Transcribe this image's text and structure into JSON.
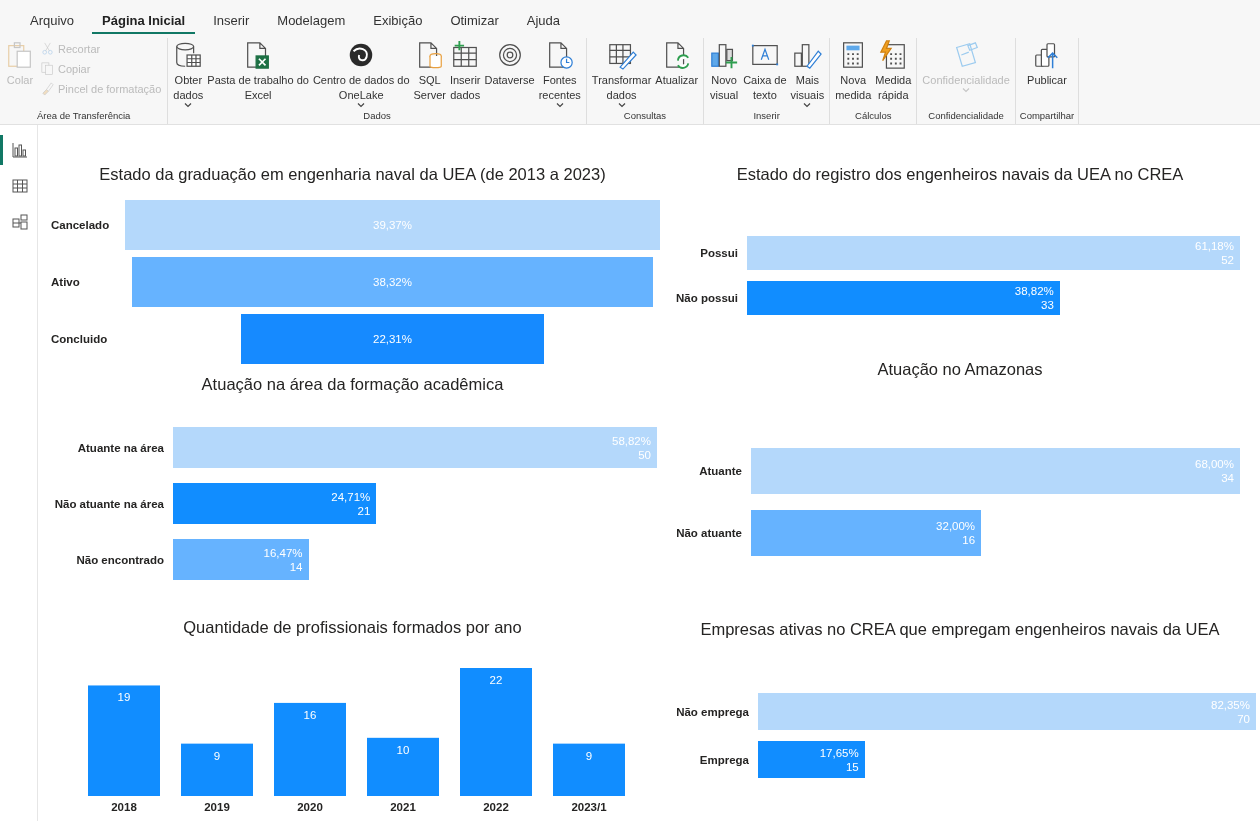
{
  "ribbon": {
    "tabs": [
      {
        "label": "Arquivo",
        "selected": false
      },
      {
        "label": "Página Inicial",
        "selected": true
      },
      {
        "label": "Inserir",
        "selected": false
      },
      {
        "label": "Modelagem",
        "selected": false
      },
      {
        "label": "Exibição",
        "selected": false
      },
      {
        "label": "Otimizar",
        "selected": false
      },
      {
        "label": "Ajuda",
        "selected": false
      }
    ],
    "groups": [
      {
        "label": "Área de Transferência",
        "items": [
          {
            "kind": "large",
            "label": "Colar",
            "disabled": true,
            "dropdown": false
          },
          {
            "kind": "small",
            "label": "Recortar",
            "disabled": true,
            "dropdown": false
          },
          {
            "kind": "small",
            "label": "Copiar",
            "disabled": true,
            "dropdown": false
          },
          {
            "kind": "small",
            "label": "Pincel de formatação",
            "disabled": true,
            "dropdown": false
          }
        ]
      },
      {
        "label": "Dados",
        "items": [
          {
            "kind": "large",
            "label": "Obter\ndados",
            "disabled": false,
            "dropdown": true
          },
          {
            "kind": "large",
            "label": "Pasta de trabalho do\nExcel",
            "disabled": false,
            "dropdown": false
          },
          {
            "kind": "large",
            "label": "Centro de dados do\nOneLake",
            "disabled": false,
            "dropdown": true
          },
          {
            "kind": "large",
            "label": "SQL\nServer",
            "disabled": false,
            "dropdown": false
          },
          {
            "kind": "large",
            "label": "Inserir\ndados",
            "disabled": false,
            "dropdown": false
          },
          {
            "kind": "large",
            "label": "Dataverse",
            "disabled": false,
            "dropdown": false
          },
          {
            "kind": "large",
            "label": "Fontes\nrecentes",
            "disabled": false,
            "dropdown": true
          }
        ]
      },
      {
        "label": "Consultas",
        "items": [
          {
            "kind": "large",
            "label": "Transformar\ndados",
            "disabled": false,
            "dropdown": true
          },
          {
            "kind": "large",
            "label": "Atualizar",
            "disabled": false,
            "dropdown": false
          }
        ]
      },
      {
        "label": "Inserir",
        "items": [
          {
            "kind": "large",
            "label": "Novo\nvisual",
            "disabled": false,
            "dropdown": false
          },
          {
            "kind": "large",
            "label": "Caixa de\ntexto",
            "disabled": false,
            "dropdown": false
          },
          {
            "kind": "large",
            "label": "Mais\nvisuais",
            "disabled": false,
            "dropdown": true
          }
        ]
      },
      {
        "label": "Cálculos",
        "items": [
          {
            "kind": "large",
            "label": "Nova\nmedida",
            "disabled": false,
            "dropdown": false
          },
          {
            "kind": "large",
            "label": "Medida\nrápida",
            "disabled": false,
            "dropdown": false
          }
        ]
      },
      {
        "label": "Confidencialidade",
        "items": [
          {
            "kind": "large",
            "label": "Confidencialidade",
            "disabled": true,
            "dropdown": true
          }
        ]
      },
      {
        "label": "Compartilhar",
        "items": [
          {
            "kind": "large",
            "label": "Publicar",
            "disabled": false,
            "dropdown": false
          }
        ]
      }
    ]
  },
  "sidebar": {
    "items": [
      {
        "selected": true
      },
      {
        "selected": false
      },
      {
        "selected": false
      }
    ]
  },
  "charts": [
    {
      "kind": "funnel",
      "title": "Estado da graduação em engenharia naval da UEA (de 2013 a 2023)",
      "bars": [
        {
          "label": "Cancelado",
          "value": "39,37%",
          "color": "#b4d8fb"
        },
        {
          "label": "Ativo",
          "value": "38,32%",
          "color": "#66b3ff"
        },
        {
          "label": "Concluido",
          "value": "22,31%",
          "color": "#168aff"
        }
      ]
    },
    {
      "kind": "bars",
      "title": "Estado do registro dos engenheiros navais da UEA no CREA",
      "bars": [
        {
          "label": "Possui",
          "value": "61,18%",
          "count": "52",
          "color": "#b4d8fb"
        },
        {
          "label": "Não possui",
          "value": "38,82%",
          "count": "33",
          "color": "#118dff"
        }
      ]
    },
    {
      "kind": "bars",
      "title": "Atuação na área da formação acadêmica",
      "bars": [
        {
          "label": "Atuante na área",
          "value": "58,82%",
          "count": "50",
          "color": "#b4d8fb"
        },
        {
          "label": "Não atuante na área",
          "value": "24,71%",
          "count": "21",
          "color": "#118dff"
        },
        {
          "label": "Não encontrado",
          "value": "16,47%",
          "count": "14",
          "color": "#66b3ff"
        }
      ]
    },
    {
      "kind": "bars",
      "title": "Atuação no Amazonas",
      "bars": [
        {
          "label": "Atuante",
          "value": "68,00%",
          "count": "34",
          "color": "#b4d8fb"
        },
        {
          "label": "Não atuante",
          "value": "32,00%",
          "count": "16",
          "color": "#66b3ff"
        }
      ]
    },
    {
      "kind": "column",
      "title": "Quantidade de profissionais formados por ano",
      "chart_data": {
        "type": "bar",
        "orientation": "vertical",
        "categories": [
          "2018",
          "2019",
          "2020",
          "2021",
          "2022",
          "2023/1"
        ],
        "series": [
          {
            "color": "#118dff",
            "values": [
              19,
              9,
              16,
              10,
              22,
              9
            ]
          }
        ],
        "data_labels": true
      }
    },
    {
      "kind": "bars",
      "title": "Empresas ativas no CREA que empregam engenheiros navais da UEA",
      "bars": [
        {
          "label": "Não emprega",
          "value": "82,35%",
          "count": "70",
          "color": "#b4d8fb"
        },
        {
          "label": "Emprega",
          "value": "17,65%",
          "count": "15",
          "color": "#118dff"
        }
      ]
    }
  ]
}
